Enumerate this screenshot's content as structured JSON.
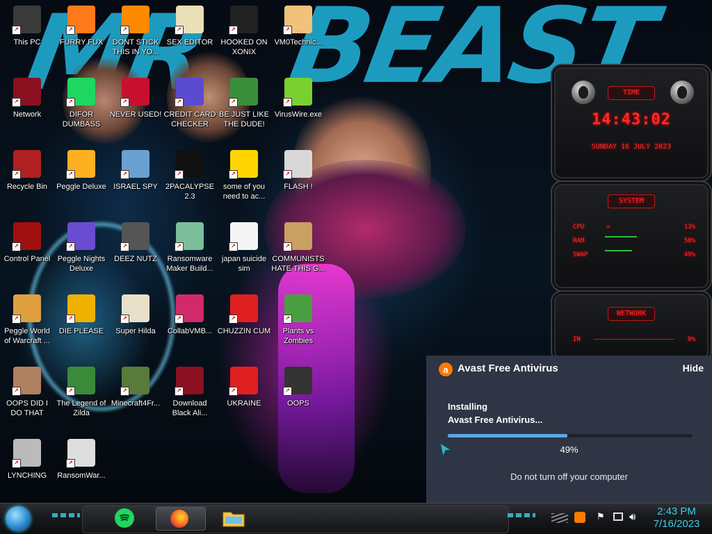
{
  "desktop": {
    "icons": [
      {
        "label": "This PC",
        "icon": "computer-icon"
      },
      {
        "label": "FURRY FUX",
        "icon": "firefox-icon"
      },
      {
        "label": "DONT STICK THIS IN YO...",
        "icon": "vlc-cone-icon"
      },
      {
        "label": "SEX EDITOR",
        "icon": "hex-editor-icon"
      },
      {
        "label": "HOOKED ON XONIX",
        "icon": "xonix-game-icon"
      },
      {
        "label": "VM0Technic...",
        "icon": "technician-icon"
      },
      {
        "label": "Network",
        "icon": "network-icon"
      },
      {
        "label": "DIFOR DUMBASS",
        "icon": "spotify-like-icon"
      },
      {
        "label": "NEVER USED!",
        "icon": "dev-cpp-icon"
      },
      {
        "label": "CREDIT CARD CHECKER",
        "icon": "credit-card-icon"
      },
      {
        "label": "BE JUST LIKE THE DUDE!",
        "icon": "santa-icon"
      },
      {
        "label": "VirusWire.exe",
        "icon": "lime-icon"
      },
      {
        "label": "Recycle Bin",
        "icon": "recycle-bin-icon"
      },
      {
        "label": "Peggle Deluxe",
        "icon": "peggle-icon"
      },
      {
        "label": "ISRAEL SPY",
        "icon": "spy-icon"
      },
      {
        "label": "2PACALYPSE 2.3",
        "icon": "terminal-icon"
      },
      {
        "label": "some of you need to ac...",
        "icon": "beaver-icon"
      },
      {
        "label": "FLASH !",
        "icon": "flash-icon"
      },
      {
        "label": "Control Panel",
        "icon": "control-panel-icon"
      },
      {
        "label": "Peggle Nights Deluxe",
        "icon": "peggle-nights-icon"
      },
      {
        "label": "DEEZ NUTZ",
        "icon": "windows-stack-icon"
      },
      {
        "label": "Ransomware Maker Build...",
        "icon": "ransomware-builder-icon"
      },
      {
        "label": "japan suicide sim",
        "icon": "document-icon"
      },
      {
        "label": "COMMUNISTS HATE THIS G...",
        "icon": "money-bag-icon"
      },
      {
        "label": "Peggle World of Warcraft ...",
        "icon": "peggle-wow-icon"
      },
      {
        "label": "DIE PLEASE",
        "icon": "de-icon"
      },
      {
        "label": "Super Hilda",
        "icon": "pixel-dog-icon"
      },
      {
        "label": "CollabVMB...",
        "icon": "collabvm-icon"
      },
      {
        "label": "CHUZZIN CUM",
        "icon": "chuzzle-icon"
      },
      {
        "label": "Plants vs Zombies",
        "icon": "plant-icon"
      },
      {
        "label": "OOPS DID I DO THAT",
        "icon": "portrait-icon"
      },
      {
        "label": "The Legend of Zilda",
        "icon": "link-sprite-icon"
      },
      {
        "label": "Minecraft4Fr...",
        "icon": "minecraft-block-icon"
      },
      {
        "label": "Download Black Ali...",
        "icon": "alienware-icon"
      },
      {
        "label": "UKRAINE",
        "icon": "radiation-icon"
      },
      {
        "label": "OOPS",
        "icon": "oops-book-icon"
      },
      {
        "label": "LYNCHING",
        "icon": "gear-flag-icon"
      },
      {
        "label": "RansomWar...",
        "icon": "skull-icon"
      }
    ]
  },
  "gadget": {
    "time_title": "TIME",
    "time": "14:43:02",
    "date": "SUNDAY 16 JULY 2023",
    "system_title": "SYSTEM",
    "cpu_label": "CPU",
    "cpu_value": "13%",
    "cpu_level": 0.13,
    "ram_label": "RAM",
    "ram_value": "58%",
    "ram_level": 0.58,
    "swap_label": "SWAP",
    "swap_value": "49%",
    "swap_level": 0.49,
    "network_title": "NETWORK",
    "in_label": "IN",
    "in_value": "0%"
  },
  "avast": {
    "title": "Avast Free Antivirus",
    "hide_label": "Hide",
    "status_line1": "Installing",
    "status_line2": "Avast Free Antivirus...",
    "progress": 0.49,
    "percent": "49%",
    "warning": "Do not turn off your computer",
    "accent": "#5aa7ea"
  },
  "taskbar": {
    "pinned": [
      {
        "icon": "spotify-like-icon"
      },
      {
        "icon": "firefox-icon"
      },
      {
        "icon": "file-explorer-icon"
      }
    ],
    "clock_time": "2:43 PM",
    "clock_date": "7/16/2023",
    "clock_color": "#3ad0e0"
  }
}
